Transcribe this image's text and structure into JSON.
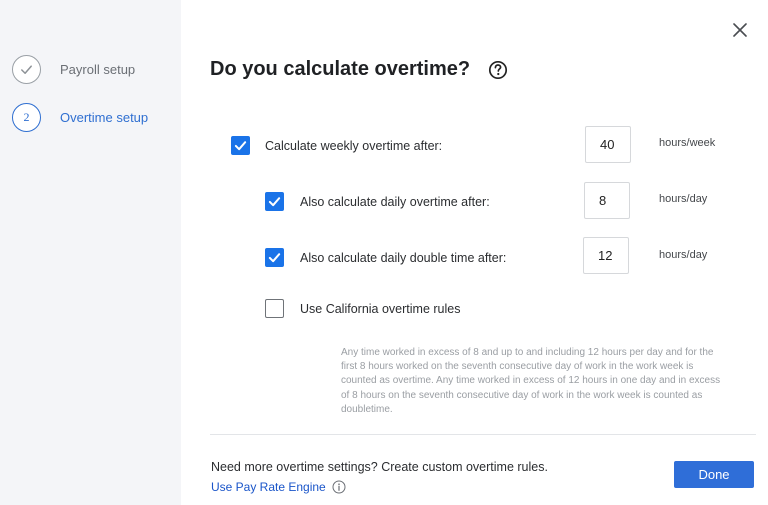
{
  "sidebar": {
    "steps": [
      {
        "label": "Payroll setup",
        "status": "complete",
        "icon": "check-icon"
      },
      {
        "label": "Overtime setup",
        "number": "2",
        "status": "active"
      }
    ]
  },
  "dialog": {
    "title": "Do you calculate overtime?",
    "close_icon": "close-icon",
    "help_icon": "help-icon"
  },
  "options": [
    {
      "label": "Calculate weekly overtime after:",
      "checked": true,
      "value": "40",
      "unit": "hours/week"
    },
    {
      "label": "Also calculate daily overtime after:",
      "checked": true,
      "value": "8",
      "unit": "hours/day"
    },
    {
      "label": "Also calculate daily double time after:",
      "checked": true,
      "value": "12",
      "unit": "hours/day"
    },
    {
      "label": "Use California overtime rules",
      "checked": false
    }
  ],
  "california_note": "Any time worked in excess of 8 and up to and including 12 hours per day and for the first 8 hours worked on the seventh consecutive day of work in the work week is counted as overtime. Any time worked in excess of 12 hours in one day and in excess of 8 hours on the seventh consecutive day of work in the work week is counted as doubletime.",
  "footer": {
    "text": "Need more overtime settings? Create custom overtime rules.",
    "link": "Use Pay Rate Engine",
    "done_label": "Done"
  },
  "colors": {
    "accent": "#1a73e8",
    "button": "#2f6ed8",
    "sidebar_bg": "#f4f5f8",
    "link": "#1a55c9"
  }
}
